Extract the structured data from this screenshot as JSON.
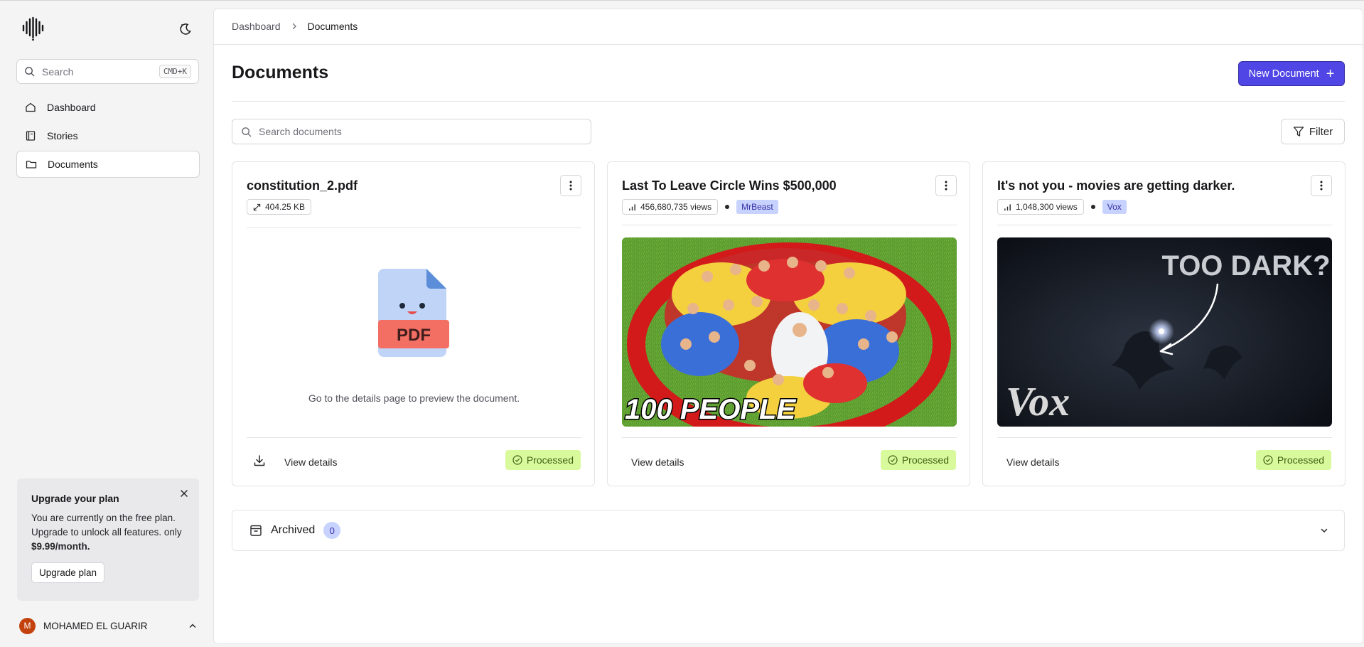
{
  "sidebar": {
    "search_placeholder": "Search",
    "search_shortcut": "CMD+K",
    "nav": [
      {
        "label": "Dashboard",
        "icon": "home-icon"
      },
      {
        "label": "Stories",
        "icon": "book-icon"
      },
      {
        "label": "Documents",
        "icon": "folder-icon",
        "active": true
      }
    ],
    "upgrade": {
      "title": "Upgrade your plan",
      "text": "You are currently on the free plan. Upgrade to unlock all features. only ",
      "price": "$9.99/month.",
      "button": "Upgrade plan"
    },
    "user": {
      "initial": "M",
      "name": "MOHAMED EL GUARIR"
    }
  },
  "breadcrumb": {
    "parent": "Dashboard",
    "current": "Documents"
  },
  "page": {
    "title": "Documents",
    "new_button": "New Document",
    "search_placeholder": "Search documents",
    "filter_label": "Filter"
  },
  "cards": [
    {
      "title": "constitution_2.pdf",
      "size": "404.25 KB",
      "preview_hint": "Go to the details page to preview the document.",
      "pdf_label": "PDF",
      "view_label": "View details",
      "status": "Processed"
    },
    {
      "title": "Last To Leave Circle Wins $500,000",
      "views": "456,680,735 views",
      "channel": "MrBeast",
      "thumb_caption": "100 PEOPLE",
      "view_label": "View details",
      "status": "Processed"
    },
    {
      "title": "It's not you - movies are getting darker.",
      "views": "1,048,300 views",
      "channel": "Vox",
      "thumb_caption": "TOO DARK?",
      "thumb_logo": "Vox",
      "view_label": "View details",
      "status": "Processed"
    }
  ],
  "archived": {
    "label": "Archived",
    "count": "0"
  },
  "colors": {
    "accent": "#4f46e5",
    "status_bg": "#d9f99d",
    "badge_bg": "#c7d2fe"
  }
}
